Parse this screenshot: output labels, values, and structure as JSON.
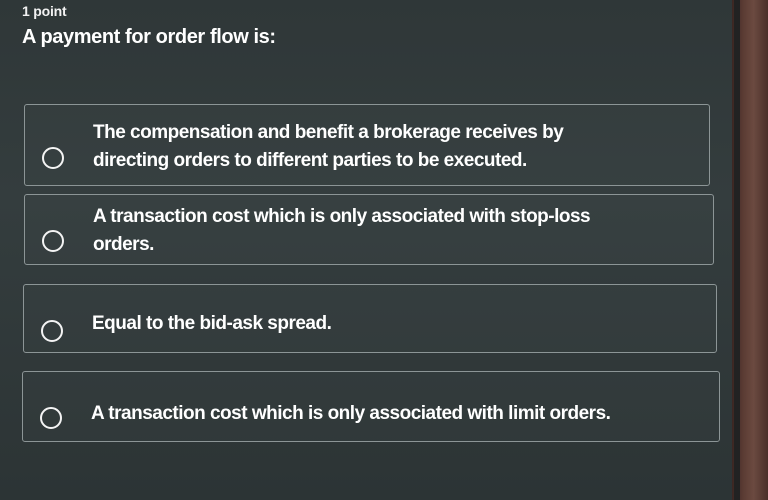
{
  "question": {
    "points": "1 point",
    "prompt": "A payment for order flow is:"
  },
  "options": [
    {
      "line1": "The compensation and benefit a brokerage receives by",
      "line2": "directing orders to different parties to be executed.",
      "selected": false
    },
    {
      "line1": "A transaction cost which is only associated with stop-loss",
      "line2": "orders.",
      "selected": false
    },
    {
      "line1": "Equal to the bid-ask spread.",
      "selected": false
    },
    {
      "line1": "A transaction cost which is only associated with limit orders.",
      "selected": false
    }
  ]
}
